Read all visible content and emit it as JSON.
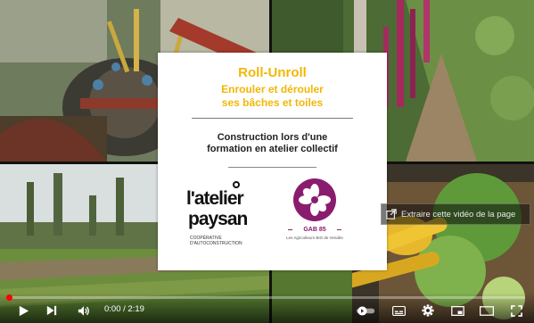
{
  "card": {
    "title": "Roll-Unroll",
    "subtitle": "Enrouler et dérouler\nses bâches et toiles",
    "description": "Construction lors d'une\nformation en atelier collectif"
  },
  "logos": {
    "atelier_paysan": {
      "line1": "l'atelier",
      "line2": "paysan",
      "tagline": "COOPÉRATIVE\nD'AUTOCONSTRUCTION"
    },
    "gab85": {
      "name": "GAB 85",
      "tagline": "Les Agriculteurs BIO de Vendée"
    }
  },
  "share_overlay": {
    "text": "Extraire cette vidéo de la page",
    "icon": "external-window-icon"
  },
  "player": {
    "current_time": "0:00",
    "separator": " / ",
    "duration": "2:19",
    "progress": 0.0,
    "icons": [
      "play-icon",
      "next-icon",
      "volume-icon",
      "autoplay-toggle-icon",
      "subtitles-icon",
      "settings-icon",
      "miniplayer-icon",
      "theater-icon",
      "fullscreen-icon"
    ]
  },
  "colors": {
    "title": "#f2b705",
    "gab_purple": "#8a1c6f",
    "progress": "#ff0000"
  }
}
